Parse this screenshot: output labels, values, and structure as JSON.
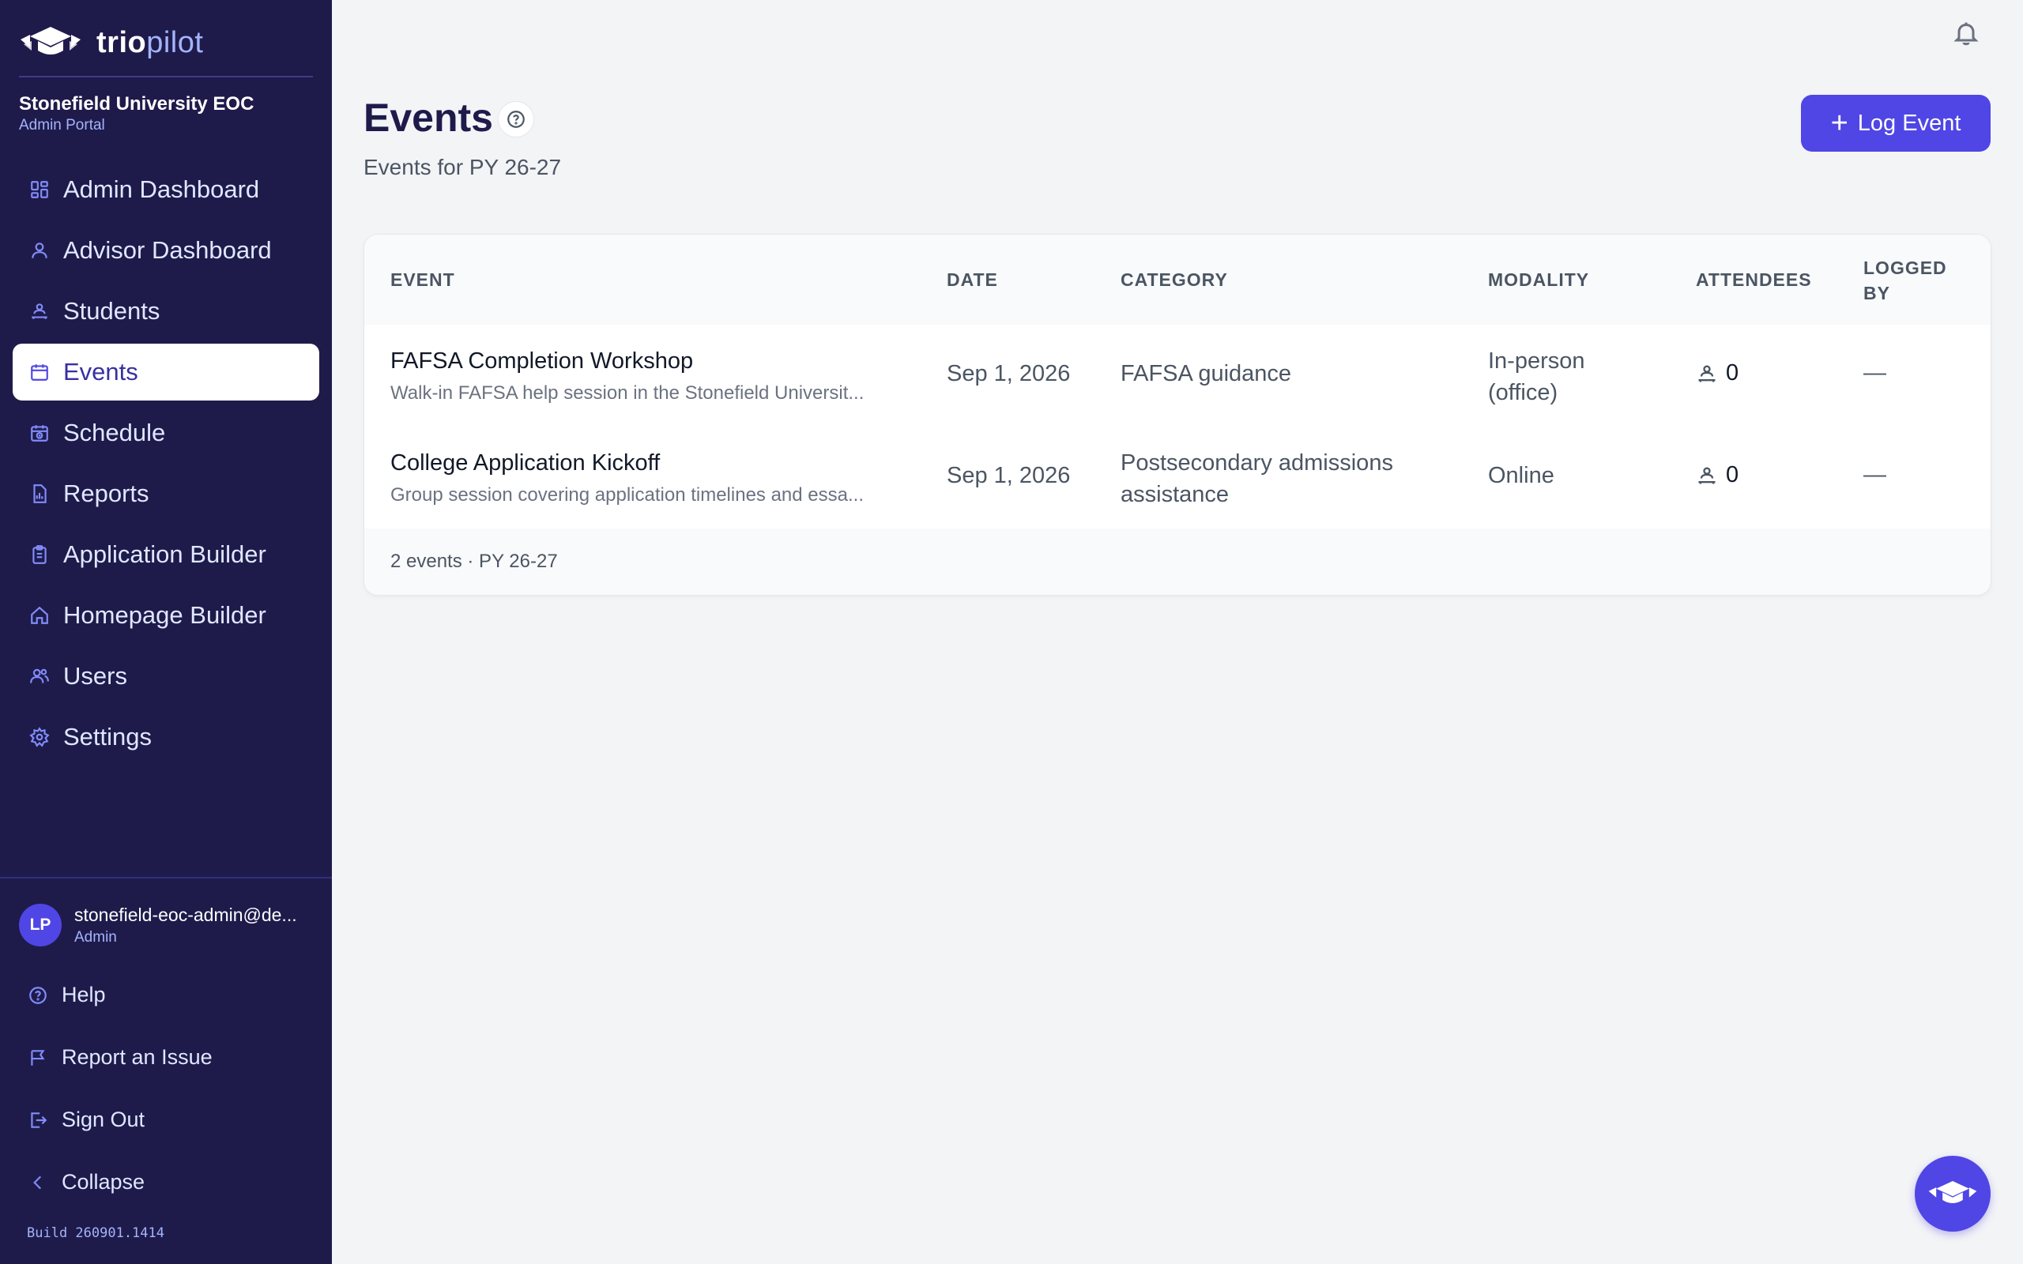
{
  "app": {
    "logo_part1": "trio",
    "logo_part2": "pilot",
    "org_name": "Stonefield University EOC",
    "org_subtitle": "Admin Portal"
  },
  "sidebar": {
    "items": [
      {
        "label": "Admin Dashboard",
        "icon": "grid-icon"
      },
      {
        "label": "Advisor Dashboard",
        "icon": "user-icon"
      },
      {
        "label": "Students",
        "icon": "students-icon"
      },
      {
        "label": "Events",
        "icon": "calendar-icon",
        "active": true
      },
      {
        "label": "Schedule",
        "icon": "schedule-icon"
      },
      {
        "label": "Reports",
        "icon": "report-icon"
      },
      {
        "label": "Application Builder",
        "icon": "clipboard-icon"
      },
      {
        "label": "Homepage Builder",
        "icon": "home-icon"
      },
      {
        "label": "Users",
        "icon": "users-icon"
      },
      {
        "label": "Settings",
        "icon": "gear-icon"
      }
    ]
  },
  "user": {
    "initials": "LP",
    "email": "stonefield-eoc-admin@de...",
    "role": "Admin"
  },
  "bottom_links": {
    "help": "Help",
    "report": "Report an Issue",
    "signout": "Sign Out",
    "collapse": "Collapse"
  },
  "build": "Build 260901.1414",
  "main": {
    "title": "Events",
    "subtitle": "Events for PY 26-27",
    "log_button": "Log Event"
  },
  "table": {
    "headers": {
      "event": "EVENT",
      "date": "DATE",
      "category": "CATEGORY",
      "modality": "MODALITY",
      "attendees": "ATTENDEES",
      "logged_by_1": "LOGGED",
      "logged_by_2": "BY"
    },
    "rows": [
      {
        "title": "FAFSA Completion Workshop",
        "description": "Walk-in FAFSA help session in the Stonefield Universit...",
        "date": "Sep 1, 2026",
        "category_1": "FAFSA guidance",
        "category_2": "",
        "modality_1": "In-person",
        "modality_2": "(office)",
        "attendees": "0",
        "logged_by": "—"
      },
      {
        "title": "College Application Kickoff",
        "description": "Group session covering application timelines and essa...",
        "date": "Sep 1, 2026",
        "category_1": "Postsecondary admissions",
        "category_2": "assistance",
        "modality_1": "Online",
        "modality_2": "",
        "attendees": "0",
        "logged_by": "—"
      }
    ],
    "footer": "2 events · PY 26-27"
  },
  "colors": {
    "sidebar_bg": "#1e1b4b",
    "accent": "#4f46e5",
    "page_bg": "#f3f4f6"
  }
}
